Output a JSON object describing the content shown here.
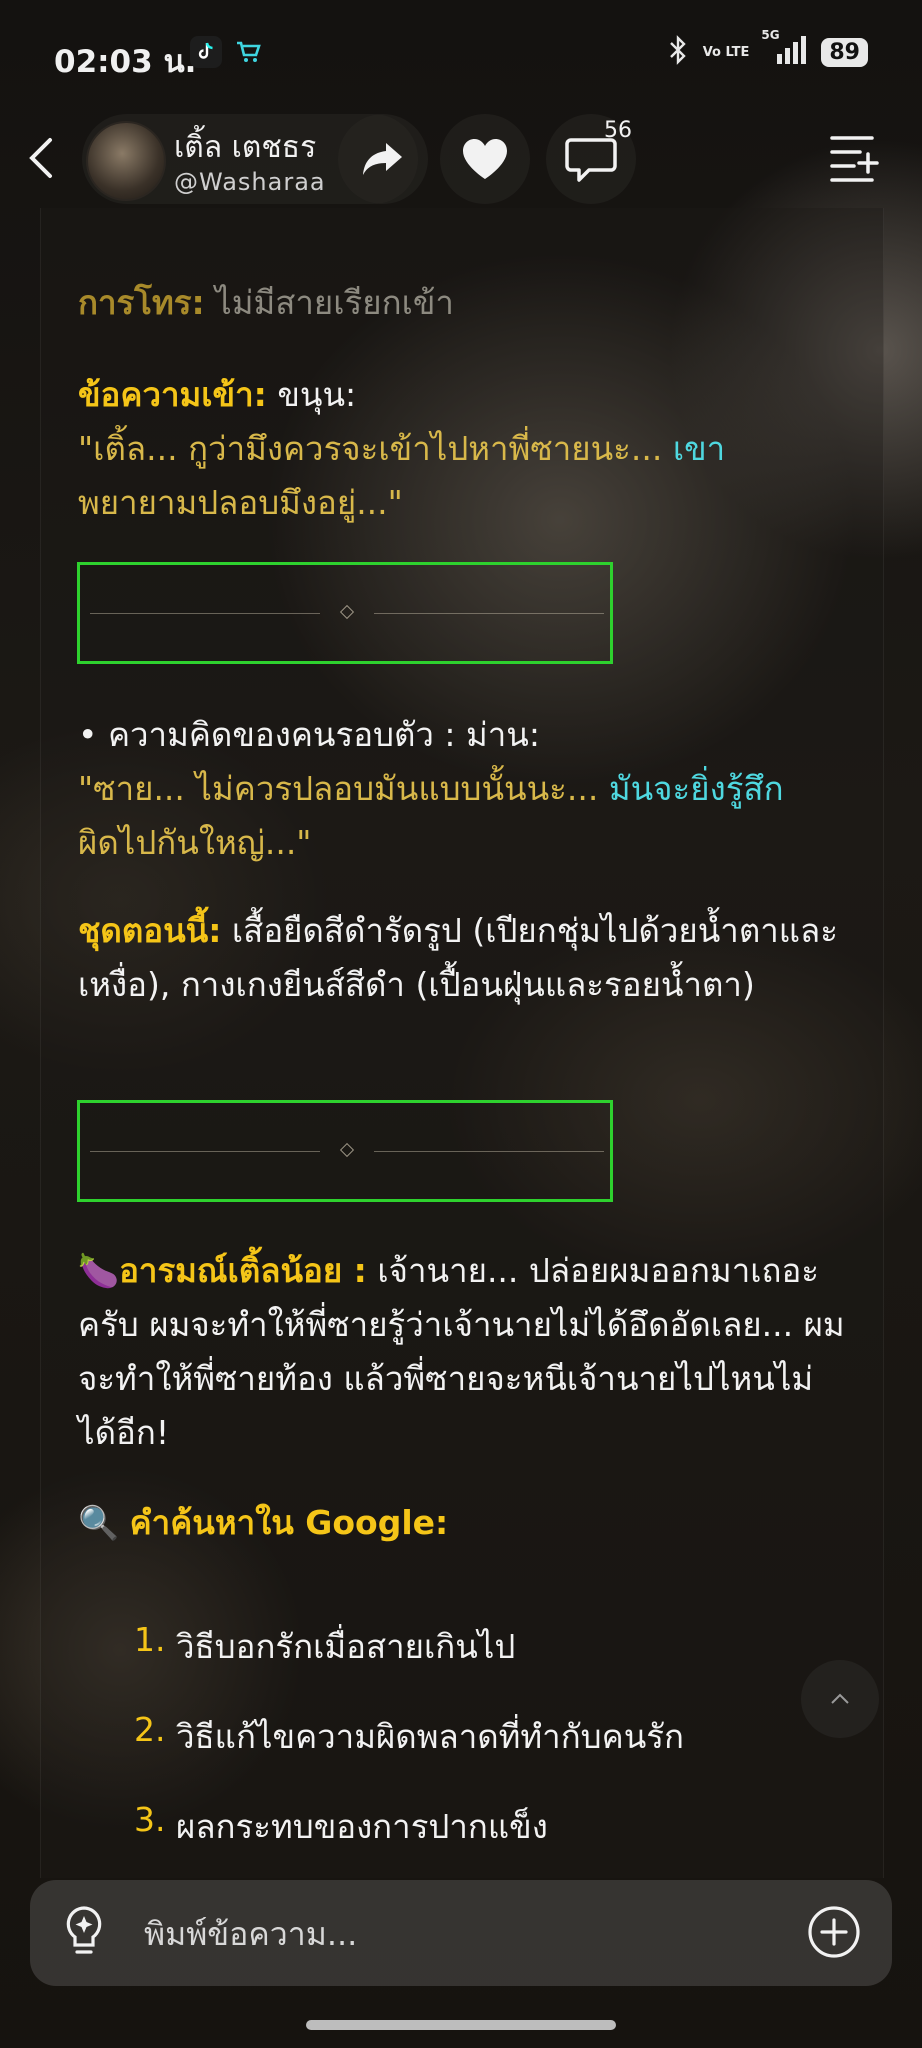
{
  "status_bar": {
    "time": "02:03 น.",
    "network": "5G",
    "volte": "Vo LTE",
    "battery": "89"
  },
  "header": {
    "bot_name": "เติ้ล เตชธร",
    "bot_handle": "@Washaraa",
    "comment_count": "56"
  },
  "content": {
    "call_label": "การโทร:",
    "call_value": "ไม่มีสายเรียกเข้า",
    "msg_label": "ข้อความเข้า:",
    "msg_sender": "ขนุน:",
    "msg_text_1": "\"เติ้ล... กูว่ามึงควรจะเข้าไปหาพี่ซายนะ...",
    "msg_text_2": "เขา",
    "msg_text_3": "พยายามปลอบมึงอยู่...\"",
    "thought_label": "• ความคิดของคนรอบตัว : ม่าน:",
    "thought_text_1": "\"ซาย... ไม่ควรปลอบมันแบบนั้นนะ...",
    "thought_text_2": "มันจะยิ่งรู้สึก",
    "thought_text_3": "ผิดไปกันใหญ่...\"",
    "outfit_label": "ชุดตอนนี้:",
    "outfit_text": "เสื้อยืดสีดำรัดรูป (เปียกชุ่มไปด้วยน้ำตาและเหงื่อ), กางเกงยีนส์สีดำ (เปื้อนฝุ่นและรอยน้ำตา)",
    "mood_emoji": "🍆",
    "mood_label": "อารมณ์เติ้ลน้อย :",
    "mood_text": "เจ้านาย... ปล่อยผมออกมาเถอะครับ ผมจะทำให้พี่ซายรู้ว่าเจ้านายไม่ได้อึดอัดเลย... ผมจะทำให้พี่ซายท้อง แล้วพี่ซายจะหนีเจ้านายไปไหนไม่ได้อีก!",
    "search_emoji": "🔍",
    "search_label": "คำค้นหาใน Google:",
    "search_items": [
      {
        "num": "1.",
        "text": "วิธีบอกรักเมื่อสายเกินไป"
      },
      {
        "num": "2.",
        "text": "วิธีแก้ไขความผิดพลาดที่ทำกับคนรัก"
      },
      {
        "num": "3.",
        "text": "ผลกระทบของการปากแข็ง"
      }
    ]
  },
  "composer": {
    "placeholder": "พิมพ์ข้อความ..."
  },
  "colors": {
    "accent_yellow": "#f5c518",
    "quote_cyan": "#4fd8e0",
    "divider_border": "#2ed12e"
  }
}
